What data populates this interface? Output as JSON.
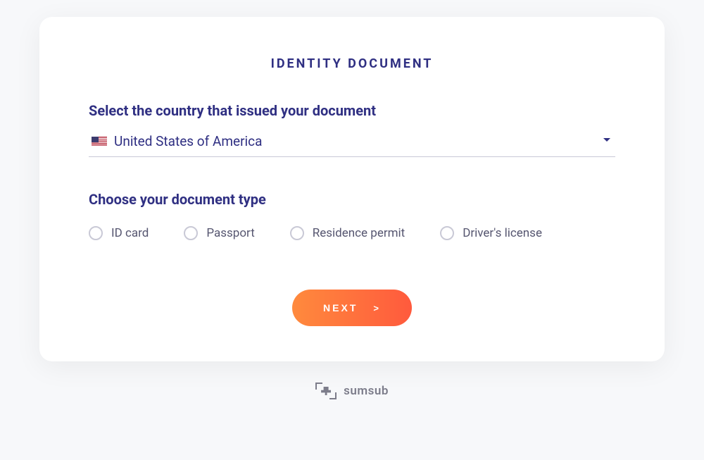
{
  "title": "IDENTITY DOCUMENT",
  "country": {
    "label": "Select the country that issued your document",
    "selected": "United States of America"
  },
  "docType": {
    "label": "Choose your document type",
    "options": [
      "ID card",
      "Passport",
      "Residence permit",
      "Driver's license"
    ]
  },
  "next": {
    "label": "NEXT",
    "arrow": ">"
  },
  "footer": {
    "brand": "sumsub"
  }
}
